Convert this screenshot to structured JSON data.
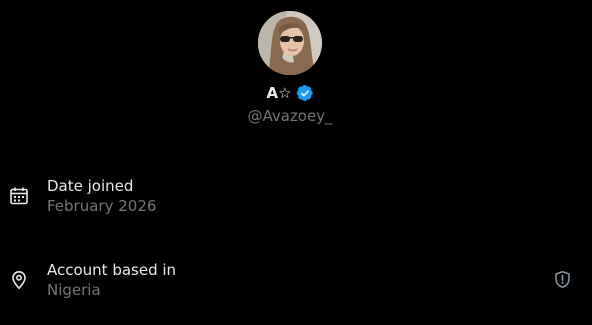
{
  "profile": {
    "display_name": "A☆",
    "handle": "@Avazoey_",
    "verified": true,
    "verified_color": "#1d9bf0",
    "avatar_icon": "avatar-photo"
  },
  "about": {
    "joined": {
      "icon": "calendar-icon",
      "label": "Date joined",
      "value": "February 2026"
    },
    "location": {
      "icon": "location-pin-icon",
      "label": "Account based in",
      "value": "Nigeria",
      "info_icon": "shield-alert-icon"
    }
  },
  "colors": {
    "background": "#000000",
    "primary_text": "#e7e9ea",
    "secondary_text": "#71767b"
  }
}
